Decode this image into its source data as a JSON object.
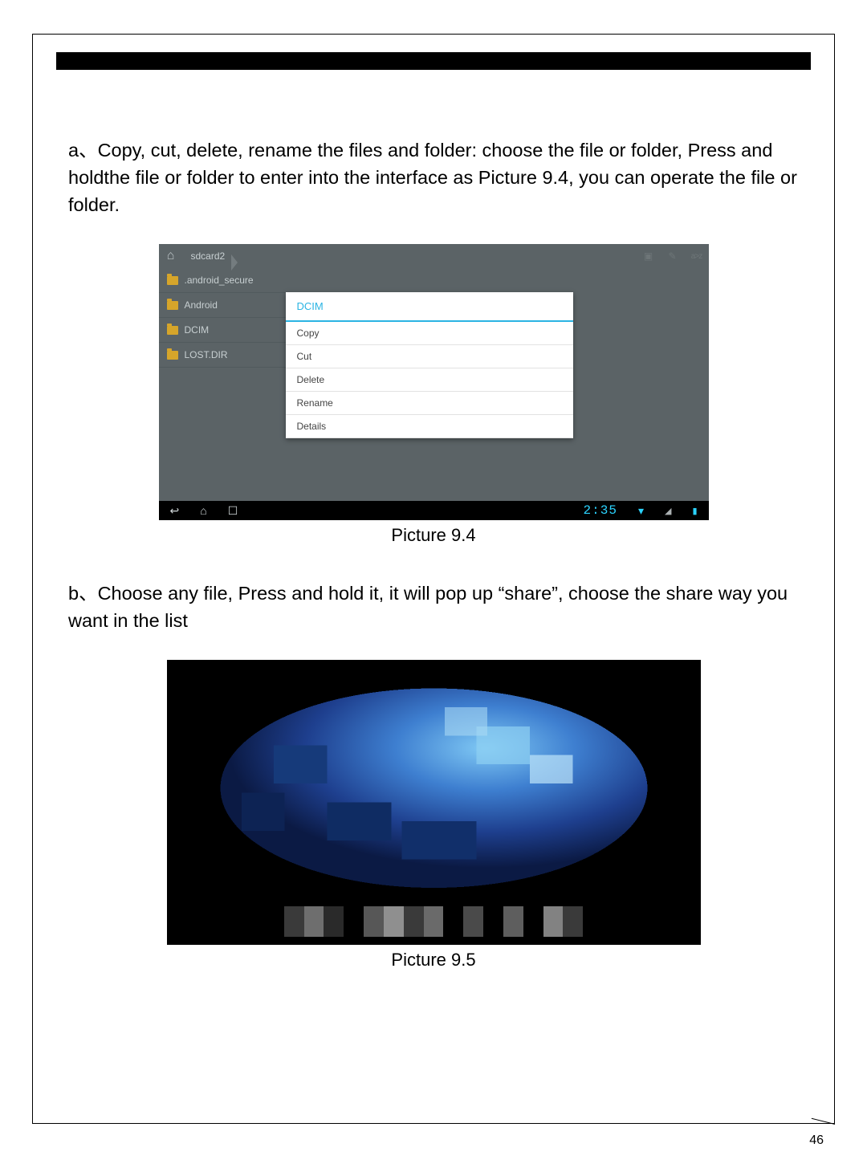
{
  "paragraph_a": "a、Copy, cut, delete, rename the files and folder: choose the file or folder, Press and holdthe file or folder to enter into the interface as Picture 9.4, you can operate the file or folder.",
  "caption_1": "Picture 9.4",
  "paragraph_b": "b、Choose any file, Press and hold it, it will pop up “share”, choose the share way you want in the list",
  "caption_2": "Picture 9.5",
  "page_number": "46",
  "screenshot1": {
    "breadcrumb": "sdcard2",
    "toolbar_sort": "a>z",
    "files": [
      ".android_secure",
      "Android",
      "DCIM",
      "LOST.DIR"
    ],
    "popup_title": "DCIM",
    "popup_options": [
      "Copy",
      "Cut",
      "Delete",
      "Rename",
      "Details"
    ],
    "status_time": "2:35"
  }
}
